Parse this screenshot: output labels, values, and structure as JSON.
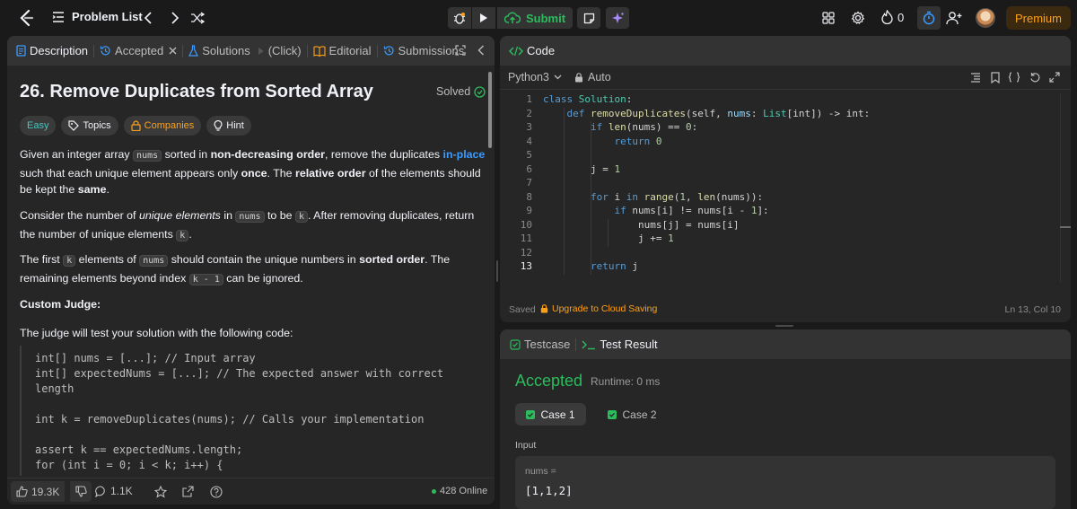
{
  "topbar": {
    "problem_list_label": "Problem List",
    "submit_label": "Submit",
    "streak_count": "0",
    "premium_label": "Premium"
  },
  "left": {
    "tabs": {
      "description": "Description",
      "accepted": "Accepted",
      "solutions": "Solutions",
      "click_hint": "(Click)",
      "editorial": "Editorial",
      "submissions": "Submissions"
    },
    "title": "26. Remove Duplicates from Sorted Array",
    "solved_label": "Solved",
    "chips": {
      "easy": "Easy",
      "topics": "Topics",
      "companies": "Companies",
      "hint": "Hint"
    },
    "p1": {
      "a": "Given an integer array ",
      "code1": "nums",
      "b": " sorted in ",
      "strong1": "non-decreasing order",
      "c": ", remove the duplicates ",
      "link": "in-place",
      "d": " such that each unique element appears only ",
      "strong2": "once",
      "e": ". The ",
      "strong3": "relative order",
      "f": " of the elements should be kept the ",
      "strong4": "same",
      "g": "."
    },
    "p2": {
      "a": "Consider the number of ",
      "em1": "unique elements",
      "b": " in ",
      "code1": "nums",
      "c": " to be ",
      "code2": "k",
      "d": ". After removing duplicates, return the number of unique elements ",
      "code3": "k",
      "e": "."
    },
    "p3": {
      "a": "The first ",
      "code1": "k",
      "b": " elements of ",
      "code2": "nums",
      "c": " should contain the unique numbers in ",
      "strong1": "sorted order",
      "d": ". The remaining elements beyond index ",
      "code3": "k - 1",
      "e": " can be ignored."
    },
    "custom_judge": "Custom Judge:",
    "p4": "The judge will test your solution with the following code:",
    "judge_code": [
      "int[] nums = [...]; // Input array",
      "int[] expectedNums = [...]; // The expected answer with correct",
      "length",
      "",
      "int k = removeDuplicates(nums); // Calls your implementation",
      "",
      "assert k == expectedNums.length;",
      "for (int i = 0; i < k; i++) {"
    ],
    "footer": {
      "likes": "19.3K",
      "comments": "1.1K",
      "online": "428 Online"
    }
  },
  "code": {
    "header": "Code",
    "language": "Python3",
    "auto_label": "Auto",
    "line_numbers": [
      "1",
      "2",
      "3",
      "4",
      "5",
      "6",
      "7",
      "8",
      "9",
      "10",
      "11",
      "12",
      "13"
    ],
    "lines": {
      "l1": {
        "kw": "class",
        "sp": " ",
        "cls": "Solution",
        "rest": ":"
      },
      "l2": {
        "indent": "    ",
        "kw": "def",
        "sp": " ",
        "fn": "removeDuplicates",
        "a": "(self, ",
        "var": "nums",
        "b": ": ",
        "cls": "List",
        "c": "[int]) -> int:"
      },
      "l3": {
        "indent": "        ",
        "kw": "if",
        "sp": " ",
        "fn": "len",
        "a": "(nums) == ",
        "num": "0",
        "b": ":"
      },
      "l4": {
        "indent": "            ",
        "kw": "return",
        "sp": " ",
        "num": "0"
      },
      "l5": "",
      "l6": {
        "indent": "        ",
        "a": "j = ",
        "num": "1"
      },
      "l7": "",
      "l8": {
        "indent": "        ",
        "kw": "for",
        "a": " i ",
        "kw2": "in",
        "sp": " ",
        "fn": "range",
        "b": "(",
        "num": "1",
        "c": ", ",
        "fn2": "len",
        "d": "(nums)):"
      },
      "l9": {
        "indent": "            ",
        "kw": "if",
        "a": " nums[i] != nums[i - ",
        "num": "1",
        "b": "]:"
      },
      "l10": {
        "indent": "                ",
        "a": "nums[j] = nums[i]"
      },
      "l11": {
        "indent": "                ",
        "a": "j += ",
        "num": "1"
      },
      "l12": "",
      "l13": {
        "indent": "        ",
        "kw": "return",
        "a": " j"
      }
    },
    "saved_label": "Saved",
    "upgrade_label": "Upgrade to Cloud Saving",
    "cursor_pos": "Ln 13, Col 10"
  },
  "test": {
    "tab_testcase": "Testcase",
    "tab_result": "Test Result",
    "status": "Accepted",
    "runtime": "Runtime: 0 ms",
    "case1": "Case 1",
    "case2": "Case 2",
    "input_label": "Input",
    "var_label": "nums =",
    "var_value": "[1,1,2]"
  },
  "colors": {
    "green": "#2cbb5d",
    "blue_link": "#3b9bff",
    "premium": "#ffa116",
    "easy_teal": "#46c6c2"
  }
}
